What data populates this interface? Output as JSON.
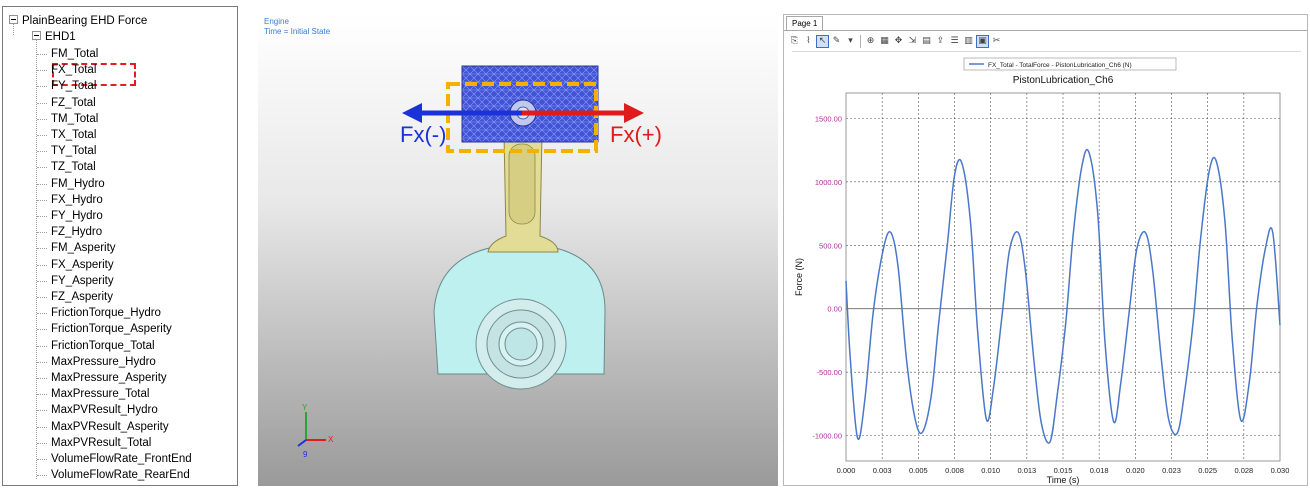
{
  "tree": {
    "root": "PlainBearing EHD Force",
    "child": "EHD1",
    "items": [
      "FM_Total",
      "FX_Total",
      "FY_Total",
      "FZ_Total",
      "TM_Total",
      "TX_Total",
      "TY_Total",
      "TZ_Total",
      "FM_Hydro",
      "FX_Hydro",
      "FY_Hydro",
      "FZ_Hydro",
      "FM_Asperity",
      "FX_Asperity",
      "FY_Asperity",
      "FZ_Asperity",
      "FrictionTorque_Hydro",
      "FrictionTorque_Asperity",
      "FrictionTorque_Total",
      "MaxPressure_Hydro",
      "MaxPressure_Asperity",
      "MaxPressure_Total",
      "MaxPVResult_Hydro",
      "MaxPVResult_Asperity",
      "MaxPVResult_Total",
      "VolumeFlowRate_FrontEnd",
      "VolumeFlowRate_RearEnd"
    ],
    "selected": "FX_Total"
  },
  "viewport": {
    "title": "Engine",
    "time": "Time = Initial State",
    "fx_neg": "Fx(-)",
    "fx_pos": "Fx(+)",
    "colors": {
      "piston": "#3f4fd0",
      "rod": "#e3dc96",
      "crank": "#bff0f0",
      "arrow_neg": "#1a32d6",
      "arrow_pos": "#e01b1b",
      "dash_box": "#f5b100"
    },
    "triad": {
      "x": "X",
      "y": "Y",
      "z": "9"
    }
  },
  "plot": {
    "tab": "Page 1",
    "toolbar_icons": [
      "copy-icon",
      "chart-icon",
      "cursor-icon",
      "pen-icon",
      "dropdown-icon",
      "zoom-icon",
      "table-icon",
      "pan-icon",
      "fit-icon",
      "open-icon",
      "export-icon",
      "align-icon",
      "grid-icon",
      "settings-icon",
      "delete-icon"
    ]
  },
  "chart_data": {
    "type": "line",
    "title": "PistonLubrication_Ch6",
    "legend": [
      "FX_Total - TotalForce - PistonLubrication_Ch6 (N)"
    ],
    "legend_position": "top-center",
    "xlabel": "Time (s)",
    "ylabel": "Force (N)",
    "xlim": [
      0,
      0.03
    ],
    "ylim": [
      -1200,
      1700
    ],
    "xticks": [
      "0.000",
      "0.003",
      "0.005",
      "0.008",
      "0.010",
      "0.013",
      "0.015",
      "0.018",
      "0.020",
      "0.023",
      "0.025",
      "0.028",
      "0.030"
    ],
    "yticks": [
      "1500.00",
      "1000.00",
      "500.00",
      "0.00",
      "-500.00",
      "-1000.00"
    ],
    "ytick_values": [
      1500,
      1000,
      500,
      0,
      -500,
      -1000
    ],
    "grid": true,
    "color": "#4a78c9",
    "series": [
      {
        "name": "FX_Total - TotalForce - PistonLubrication_Ch6 (N)",
        "x": [
          0,
          0.0003,
          0.0008,
          0.0013,
          0.0019,
          0.0026,
          0.0031,
          0.0036,
          0.0042,
          0.0048,
          0.0053,
          0.0059,
          0.0064,
          0.007,
          0.0075,
          0.008,
          0.0086,
          0.0091,
          0.0097,
          0.0102,
          0.0108,
          0.0113,
          0.0119,
          0.0124,
          0.013,
          0.0135,
          0.0141,
          0.0146,
          0.0152,
          0.0157,
          0.0163,
          0.0168,
          0.0174,
          0.0179,
          0.0185,
          0.019,
          0.0196,
          0.0201,
          0.0207,
          0.0212,
          0.0218,
          0.0223,
          0.0229,
          0.0234,
          0.024,
          0.0245,
          0.0251,
          0.0256,
          0.0262,
          0.0267,
          0.0273,
          0.0279,
          0.0284,
          0.029,
          0.0295,
          0.03
        ],
        "y": [
          220,
          -400,
          -1020,
          -720,
          -10,
          480,
          600,
          330,
          -420,
          -880,
          -970,
          -680,
          -120,
          500,
          1050,
          1150,
          690,
          -180,
          -870,
          -620,
          -40,
          460,
          600,
          300,
          -420,
          -900,
          -1050,
          -680,
          -100,
          580,
          1120,
          1230,
          750,
          -260,
          -890,
          -580,
          0,
          470,
          600,
          300,
          -400,
          -870,
          -980,
          -660,
          -100,
          540,
          1080,
          1160,
          680,
          -240,
          -880,
          -560,
          20,
          480,
          600,
          -130
        ]
      }
    ]
  }
}
